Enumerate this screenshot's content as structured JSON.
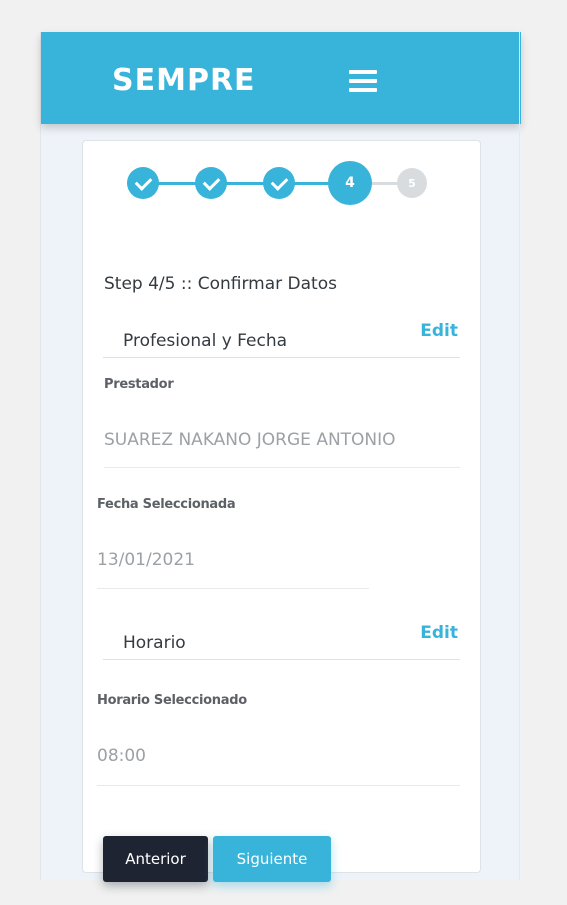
{
  "header": {
    "brand": "SEMPRE",
    "menu_icon": "hamburger-menu-icon",
    "color": "#38b4da"
  },
  "stepper": {
    "current": 4,
    "total": 5,
    "steps": [
      {
        "label": "",
        "state": "done",
        "icon": "check-icon"
      },
      {
        "label": "",
        "state": "done",
        "icon": "check-icon"
      },
      {
        "label": "",
        "state": "done",
        "icon": "check-icon"
      },
      {
        "label": "4",
        "state": "current"
      },
      {
        "label": "5",
        "state": "todo"
      }
    ]
  },
  "form": {
    "step_title": "Step 4/5 :: Confirmar Datos",
    "section_professional": {
      "title": "Profesional y Fecha",
      "edit_label": "Edit"
    },
    "prestador": {
      "label": "Prestador",
      "value": "SUAREZ NAKANO JORGE ANTONIO"
    },
    "fecha": {
      "label": "Fecha Seleccionada",
      "value": "13/01/2021"
    },
    "section_horario": {
      "title": "Horario",
      "edit_label": "Edit"
    },
    "horario": {
      "label": "Horario Seleccionado",
      "value": "08:00"
    }
  },
  "buttons": {
    "previous": "Anterior",
    "next": "Siguiente"
  },
  "colors": {
    "accent": "#38b4da",
    "dark_button": "#1f2433",
    "step_todo": "#d9dcdf"
  }
}
